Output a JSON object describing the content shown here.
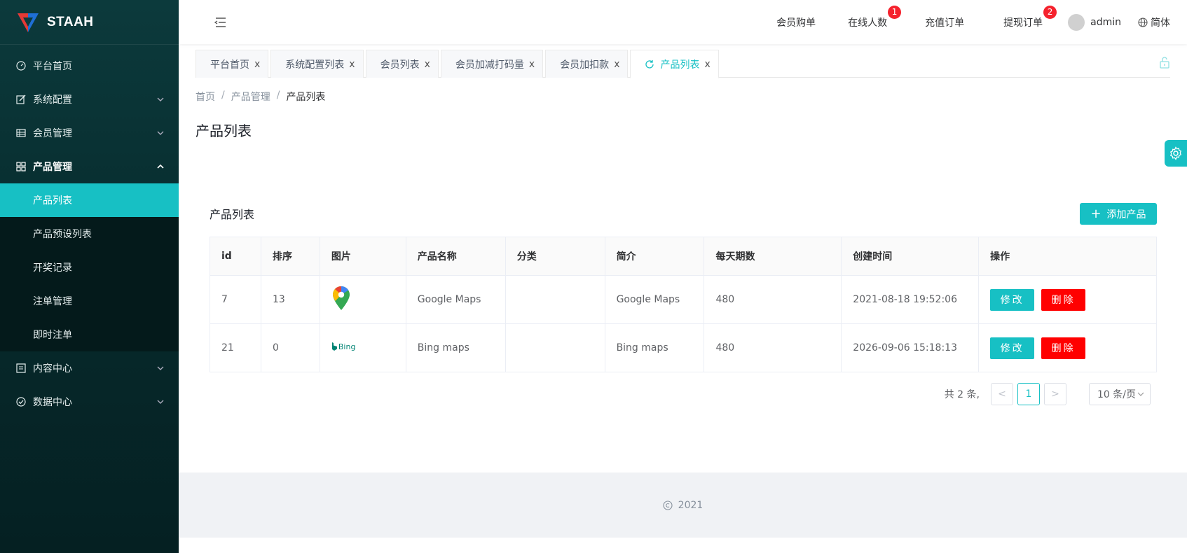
{
  "app": {
    "name": "STAAH"
  },
  "sidebar": {
    "items": [
      {
        "label": "平台首页"
      },
      {
        "label": "系统配置"
      },
      {
        "label": "会员管理"
      },
      {
        "label": "产品管理"
      },
      {
        "label": "内容中心"
      },
      {
        "label": "数据中心"
      }
    ],
    "product_sub": [
      {
        "label": "产品列表"
      },
      {
        "label": "产品预设列表"
      },
      {
        "label": "开奖记录"
      },
      {
        "label": "注单管理"
      },
      {
        "label": "即时注单"
      }
    ]
  },
  "header": {
    "links": [
      {
        "label": "会员购单"
      },
      {
        "label": "在线人数",
        "badge": "1"
      },
      {
        "label": "充值订单"
      },
      {
        "label": "提现订单",
        "badge": "2"
      }
    ],
    "user": "admin",
    "lang": "简体"
  },
  "tabs": [
    {
      "label": "平台首页"
    },
    {
      "label": "系统配置列表"
    },
    {
      "label": "会员列表"
    },
    {
      "label": "会员加减打码量"
    },
    {
      "label": "会员加扣款"
    },
    {
      "label": "产品列表"
    }
  ],
  "tab_close": "x",
  "breadcrumb": {
    "home": "首页",
    "mid": "产品管理",
    "current": "产品列表",
    "sep": "/"
  },
  "page_title": "产品列表",
  "card": {
    "title": "产品列表",
    "add_button": "添加产品",
    "add_plus": "+"
  },
  "table": {
    "headers": [
      "id",
      "排序",
      "图片",
      "产品名称",
      "分类",
      "简介",
      "每天期数",
      "创建时间",
      "操作"
    ],
    "rows": [
      {
        "id": "7",
        "sort": "13",
        "image": "google-maps-logo",
        "name": "Google Maps",
        "category": "",
        "intro": "Google Maps",
        "periods": "480",
        "created": "2021-08-18 19:52:06"
      },
      {
        "id": "21",
        "sort": "0",
        "image": "bing-logo",
        "image_text": "Bing",
        "name": "Bing maps",
        "category": "",
        "intro": "Bing maps",
        "periods": "480",
        "created": "2026-09-06 15:18:13"
      }
    ],
    "edit_label": "修改",
    "delete_label": "删除"
  },
  "pagination": {
    "total": "共 2 条,",
    "current": "1",
    "prev": "<",
    "next": ">",
    "page_size": "10 条/页"
  },
  "footer": {
    "year": "2021"
  },
  "colors": {
    "accent": "#17c0c4",
    "danger": "#ff0000",
    "sidebar_bg": "#06292b"
  }
}
